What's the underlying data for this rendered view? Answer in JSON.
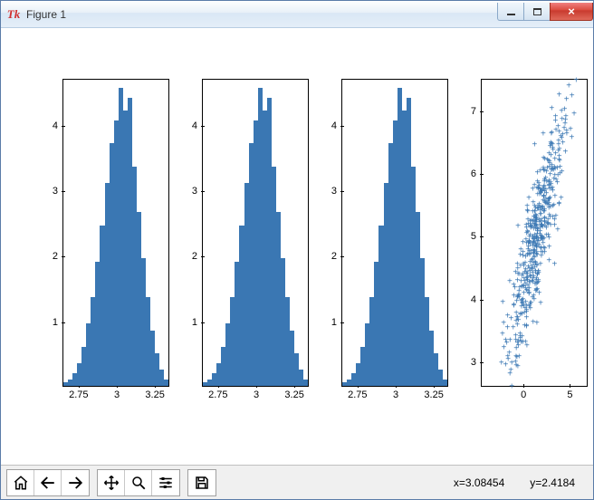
{
  "window": {
    "title": "Figure 1",
    "app_icon": "Tk"
  },
  "toolbar": {
    "buttons": [
      "home",
      "back",
      "forward",
      "pan",
      "zoom",
      "configure",
      "save"
    ]
  },
  "status": {
    "x_label": "x",
    "x_val": "3.08454",
    "y_label": "y",
    "y_val": "2.4184"
  },
  "chart_data": [
    {
      "type": "bar",
      "title": "",
      "xlabel": "",
      "ylabel": "",
      "xlim": [
        2.65,
        3.35
      ],
      "ylim": [
        0,
        4.7
      ],
      "x_ticks": [
        2.75,
        3.0,
        3.25
      ],
      "y_ticks": [
        1,
        2,
        3,
        4
      ],
      "bin_edges": [
        2.65,
        2.68,
        2.71,
        2.74,
        2.77,
        2.8,
        2.83,
        2.86,
        2.89,
        2.92,
        2.95,
        2.98,
        3.01,
        3.04,
        3.07,
        3.1,
        3.13,
        3.16,
        3.19,
        3.22,
        3.25,
        3.28,
        3.31,
        3.34
      ],
      "values": [
        0.05,
        0.1,
        0.2,
        0.35,
        0.6,
        0.95,
        1.35,
        1.9,
        2.45,
        3.1,
        3.7,
        4.05,
        4.55,
        4.2,
        4.4,
        3.35,
        2.65,
        1.95,
        1.35,
        0.85,
        0.5,
        0.25,
        0.1
      ]
    },
    {
      "type": "bar",
      "xlim": [
        2.65,
        3.35
      ],
      "ylim": [
        0,
        4.7
      ],
      "x_ticks": [
        2.75,
        3.0,
        3.25
      ],
      "y_ticks": [
        1,
        2,
        3,
        4
      ],
      "bin_edges": [
        2.65,
        2.68,
        2.71,
        2.74,
        2.77,
        2.8,
        2.83,
        2.86,
        2.89,
        2.92,
        2.95,
        2.98,
        3.01,
        3.04,
        3.07,
        3.1,
        3.13,
        3.16,
        3.19,
        3.22,
        3.25,
        3.28,
        3.31,
        3.34
      ],
      "values": [
        0.05,
        0.1,
        0.2,
        0.35,
        0.6,
        0.95,
        1.35,
        1.9,
        2.45,
        3.1,
        3.7,
        4.05,
        4.55,
        4.2,
        4.4,
        3.35,
        2.65,
        1.95,
        1.35,
        0.85,
        0.5,
        0.25,
        0.1
      ]
    },
    {
      "type": "bar",
      "xlim": [
        2.65,
        3.35
      ],
      "ylim": [
        0,
        4.7
      ],
      "x_ticks": [
        2.75,
        3.0,
        3.25
      ],
      "y_ticks": [
        1,
        2,
        3,
        4
      ],
      "bin_edges": [
        2.65,
        2.68,
        2.71,
        2.74,
        2.77,
        2.8,
        2.83,
        2.86,
        2.89,
        2.92,
        2.95,
        2.98,
        3.01,
        3.04,
        3.07,
        3.1,
        3.13,
        3.16,
        3.19,
        3.22,
        3.25,
        3.28,
        3.31,
        3.34
      ],
      "values": [
        0.05,
        0.1,
        0.2,
        0.35,
        0.6,
        0.95,
        1.35,
        1.9,
        2.45,
        3.1,
        3.7,
        4.05,
        4.55,
        4.2,
        4.4,
        3.35,
        2.65,
        1.95,
        1.35,
        0.85,
        0.5,
        0.25,
        0.1
      ]
    },
    {
      "type": "scatter",
      "xlim": [
        -4.5,
        7
      ],
      "ylim": [
        2.6,
        7.5
      ],
      "x_ticks": [
        0,
        5
      ],
      "y_ticks": [
        3,
        4,
        5,
        6,
        7
      ],
      "marker": "+",
      "n_points": 500,
      "distribution": "bivariate-normal approx; dense elongated cloud centered near (1.5, 5), positive correlation, few outliers left/low"
    }
  ]
}
